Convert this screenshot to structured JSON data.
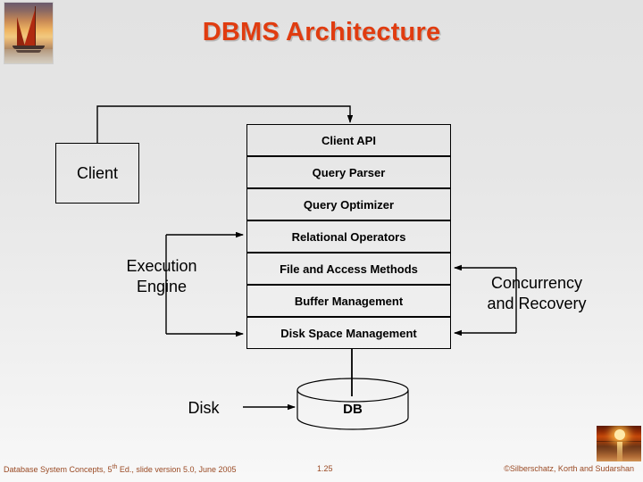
{
  "slide": {
    "title": "DBMS Architecture",
    "title_color": "#e03c10",
    "background_top": "#e2e2e2",
    "background_bottom": "#f8f8f8"
  },
  "images": {
    "top_left": "sailboat-sunset-photo",
    "bottom_right": "sunset-over-water-photo"
  },
  "diagram": {
    "client_box": "Client",
    "stack": [
      "Client API",
      "Query Parser",
      "Query Optimizer",
      "Relational Operators",
      "File and Access Methods",
      "Buffer Management",
      "Disk Space Management"
    ],
    "execution_engine": "Execution\nEngine",
    "execution_engine_line1": "Execution",
    "execution_engine_line2": "Engine",
    "concurrency_line1": "Concurrency",
    "concurrency_line2": "and Recovery",
    "disk_label": "Disk",
    "db_label": "DB"
  },
  "footer": {
    "source_prefix": "Database System Concepts, 5",
    "source_sup": "th",
    "source_suffix": " Ed., slide version 5.0, June 2005",
    "page_number": "1.25",
    "copyright": "©Silberschatz, Korth and Sudarshan",
    "color": "#9a4a24"
  }
}
